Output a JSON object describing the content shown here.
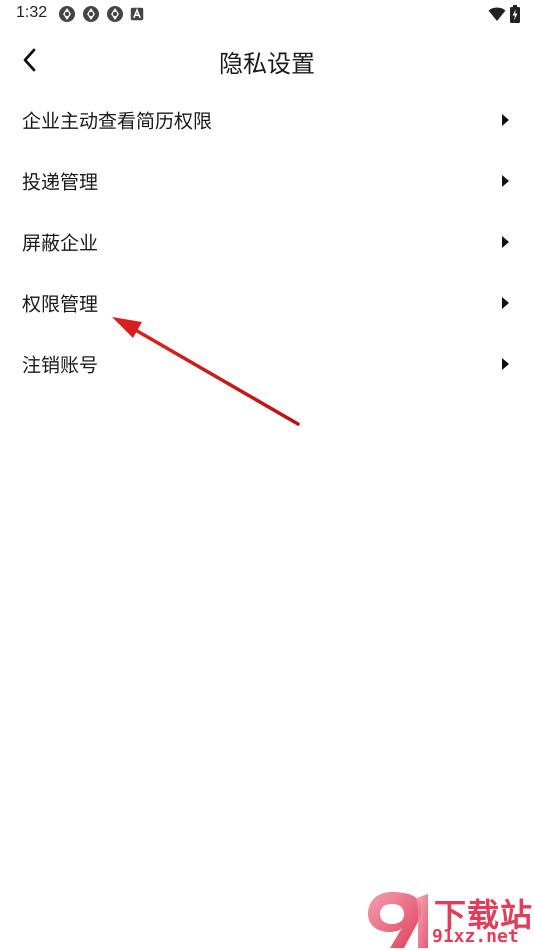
{
  "status_bar": {
    "time": "1:32",
    "left_icons": [
      "app-notification-icon",
      "app-notification-icon",
      "app-notification-icon",
      "a-badge-icon"
    ],
    "right_icons": [
      "wifi-icon",
      "battery-charging-icon"
    ]
  },
  "header": {
    "title": "隐私设置",
    "back_icon": "chevron-left-icon"
  },
  "menu": {
    "items": [
      {
        "label": "企业主动查看简历权限"
      },
      {
        "label": "投递管理"
      },
      {
        "label": "屏蔽企业"
      },
      {
        "label": "权限管理"
      },
      {
        "label": "注销账号"
      }
    ]
  },
  "annotation": {
    "color": "#d81e1e",
    "target_item": "权限管理"
  },
  "watermark": {
    "brand": "下载站",
    "domain": "91xz.net",
    "color": "#e03e5a"
  }
}
